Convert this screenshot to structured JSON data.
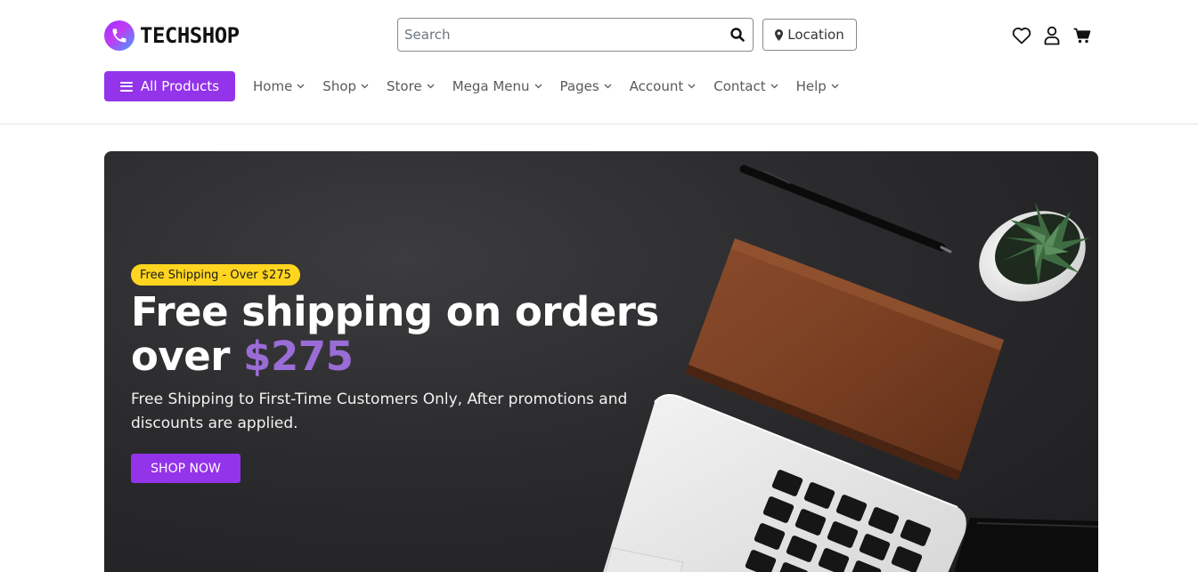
{
  "header": {
    "brand": "TECHSHOP",
    "search": {
      "placeholder": "Search",
      "value": ""
    },
    "location_label": "Location",
    "icons": [
      "heart-icon",
      "user-icon",
      "cart-icon"
    ]
  },
  "nav": {
    "all_products_label": "All Products",
    "items": [
      {
        "label": "Home"
      },
      {
        "label": "Shop"
      },
      {
        "label": "Store"
      },
      {
        "label": "Mega Menu"
      },
      {
        "label": "Pages"
      },
      {
        "label": "Account"
      },
      {
        "label": "Contact"
      },
      {
        "label": "Help"
      }
    ]
  },
  "hero": {
    "badge": "Free Shipping - Over $275",
    "title_line1": "Free shipping on orders",
    "title_prefix": "over",
    "title_accent": "$275",
    "subtitle": "Free Shipping to First-Time Customers Only, After promotions and discounts are applied.",
    "cta_label": "SHOP NOW"
  },
  "colors": {
    "primary": "#9333ea",
    "badge_bg": "#ffd51f",
    "accent_text": "#9a6cd6",
    "hero_bg": "#2b2b2d"
  }
}
